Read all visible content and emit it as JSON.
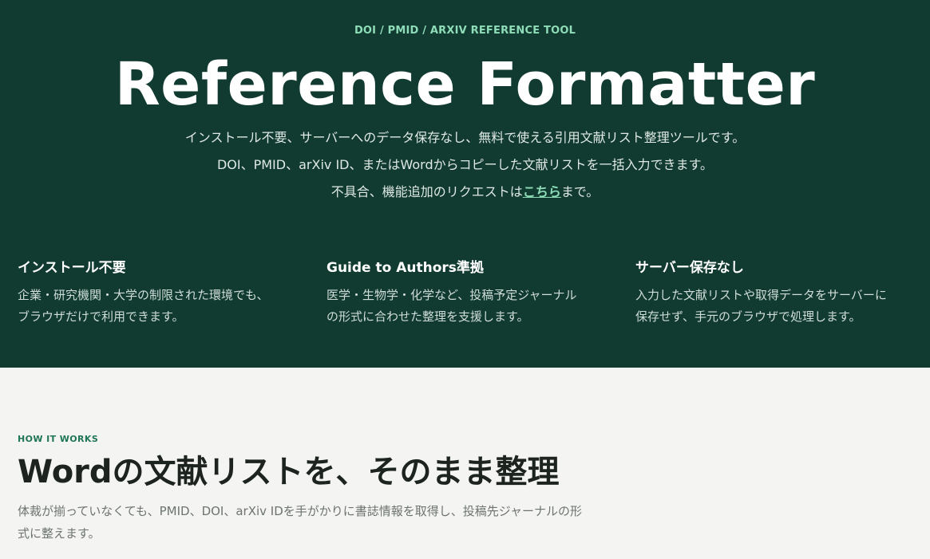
{
  "hero": {
    "eyebrow": "DOI / PMID / ARXIV REFERENCE TOOL",
    "title": "Reference Formatter",
    "lead_line1": "インストール不要、サーバーへのデータ保存なし、無料で使える引用文献リスト整理ツールです。",
    "lead_line2": "DOI、PMID、arXiv ID、またはWordからコピーした文献リストを一括入力できます。",
    "lead_line3_prefix": "不具合、機能追加のリクエストは",
    "lead_line3_link": "こちら",
    "lead_line3_suffix": "まで。",
    "link_color": "#8fdcb8",
    "background_color": "#113b31"
  },
  "features": [
    {
      "title": "インストール不要",
      "desc_line1": "企業・研究機関・大学の制限された環境でも、",
      "desc_line2": "ブラウザだけで利用できます。"
    },
    {
      "title": "Guide to Authors準拠",
      "desc_line1": "医学・生物学・化学など、投稿予定ジャーナル",
      "desc_line2": "の形式に合わせた整理を支援します。"
    },
    {
      "title": "サーバー保存なし",
      "desc_line1": "入力した文献リストや取得データをサーバーに",
      "desc_line2": "保存せず、手元のブラウザで処理します。"
    }
  ],
  "how_it_works": {
    "eyebrow": "HOW IT WORKS",
    "title": "Wordの文献リストを、そのまま整理",
    "desc_line1": "体裁が揃っていなくても、PMID、DOI、arXiv IDを手がかりに書誌情報を取得し、投稿先ジャーナルの形",
    "desc_line2": "式に整えます。",
    "accent_color": "#1f7556",
    "background_color": "#f4f4f2"
  }
}
